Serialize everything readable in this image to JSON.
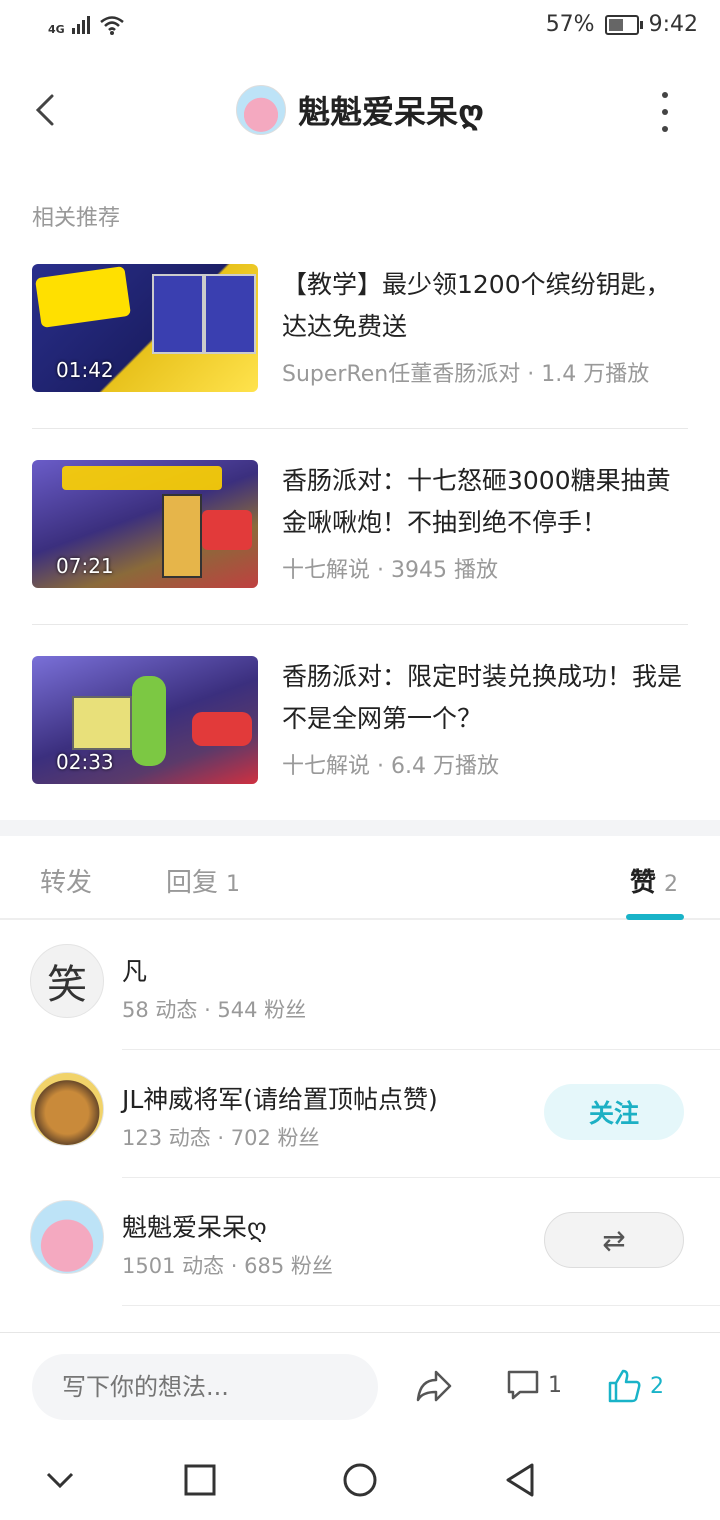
{
  "status_bar": {
    "network": "4G",
    "battery": "57%",
    "time": "9:42",
    "battery_level": 0.57
  },
  "header": {
    "title": "魁魁爱呆呆ღ"
  },
  "recommend": {
    "label": "相关推荐",
    "items": [
      {
        "title": "【教学】最少领1200个缤纷钥匙，达达免费送",
        "author": "SuperRen任董香肠派对",
        "plays": "1.4 万播放",
        "duration": "01:42"
      },
      {
        "title": "香肠派对：十七怒砸3000糖果抽黄金啾啾炮！不抽到绝不停手！",
        "author": "十七解说",
        "plays": "3945 播放",
        "duration": "07:21"
      },
      {
        "title": "香肠派对：限定时装兑换成功！我是不是全网第一个？",
        "author": "十七解说",
        "plays": "6.4 万播放",
        "duration": "02:33"
      }
    ]
  },
  "tabs": [
    {
      "label": "转发",
      "count": ""
    },
    {
      "label": "回复",
      "count": "1"
    },
    {
      "label": "赞",
      "count": "2"
    }
  ],
  "users": [
    {
      "name": "凡",
      "meta": "58 动态 · 544 粉丝",
      "avatar_char": "笑"
    },
    {
      "name": "JL神威将军(请给置顶帖点赞)",
      "meta": "123 动态 · 702 粉丝",
      "button": "关注"
    },
    {
      "name": "魁魁爱呆呆ღ",
      "meta": "1501 动态 · 685 粉丝",
      "button": "⇄"
    }
  ],
  "bottom_bar": {
    "placeholder": "写下你的想法...",
    "comment_count": "1",
    "like_count": "2"
  },
  "colors": {
    "accent": "#19b3c8"
  }
}
